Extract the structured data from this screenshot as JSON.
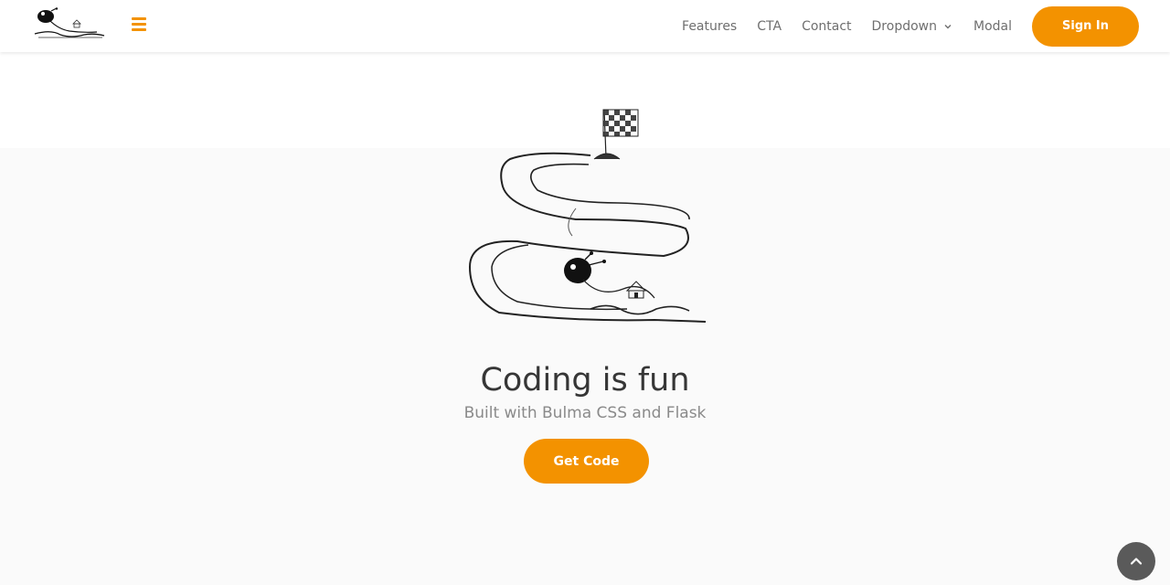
{
  "theme": {
    "accent": "#f39200",
    "backtop_bg": "#5a5a5a"
  },
  "navbar": {
    "logo_icon": "snail-on-track-logo",
    "menu_icon": "hamburger-menu-icon",
    "links": [
      {
        "label": "Features"
      },
      {
        "label": "CTA"
      },
      {
        "label": "Contact"
      },
      {
        "label": "Dropdown",
        "icon": "chevron-down-icon"
      },
      {
        "label": "Modal"
      }
    ],
    "signin_label": "Sign In"
  },
  "hero": {
    "illustration": "snail-race-track-with-checkered-flag",
    "title": "Coding is fun",
    "subtitle": "Built with Bulma CSS and Flask",
    "cta_label": "Get Code"
  },
  "back_to_top": {
    "icon": "chevron-up-icon"
  }
}
